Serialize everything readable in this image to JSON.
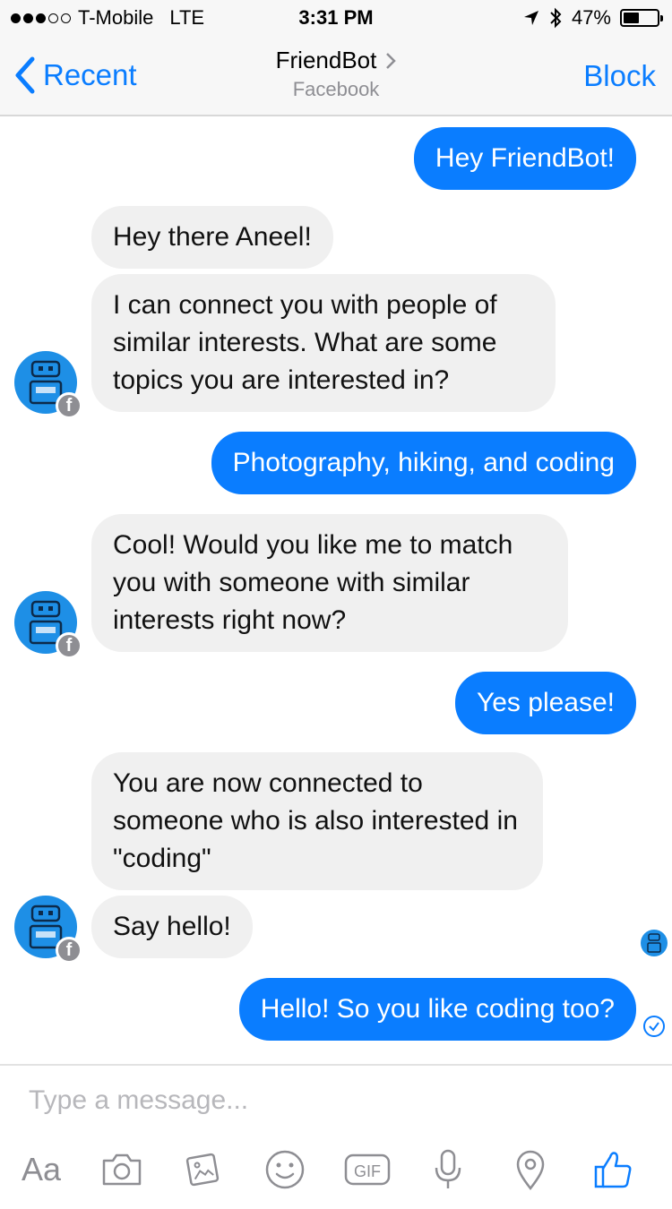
{
  "status_bar": {
    "carrier": "T-Mobile",
    "network": "LTE",
    "time": "3:31 PM",
    "battery": "47%",
    "battery_level": 0.47,
    "signal_bars": 3
  },
  "nav": {
    "back_label": "Recent",
    "title": "FriendBot",
    "subtitle": "Facebook",
    "block_label": "Block"
  },
  "messages": [
    {
      "direction": "out",
      "text": "Hey FriendBot!"
    },
    {
      "direction": "in",
      "text": "Hey there Aneel!"
    },
    {
      "direction": "in",
      "text": "I can connect you with people of similar interests. What are some topics you are interested in?"
    },
    {
      "direction": "out",
      "text": "Photography, hiking, and coding"
    },
    {
      "direction": "in",
      "text": "Cool! Would you like me to match you with someone with similar interests right now?"
    },
    {
      "direction": "out",
      "text": "Yes please!"
    },
    {
      "direction": "in",
      "text": "You are now connected to someone who is also interested in \"coding\""
    },
    {
      "direction": "in",
      "text": "Say hello!"
    },
    {
      "direction": "out",
      "text": "Hello! So you like coding too?"
    }
  ],
  "composer": {
    "placeholder": "Type a message...",
    "aa_label": "Aa",
    "gif_label": "GIF"
  },
  "avatar_badge": "f",
  "colors": {
    "accent": "#0a7dff",
    "incoming_bubble": "#f0f0f0",
    "avatar_bg": "#1e8fe6",
    "icon_gray": "#8e8e93"
  },
  "icons": [
    "chevron-left-icon",
    "chevron-right-icon",
    "location-arrow-icon",
    "bluetooth-icon",
    "battery-icon",
    "robot-avatar-icon",
    "facebook-badge-icon",
    "read-receipt-icon",
    "camera-icon",
    "gallery-icon",
    "emoji-icon",
    "gif-icon",
    "microphone-icon",
    "location-pin-icon",
    "thumbs-up-icon"
  ]
}
